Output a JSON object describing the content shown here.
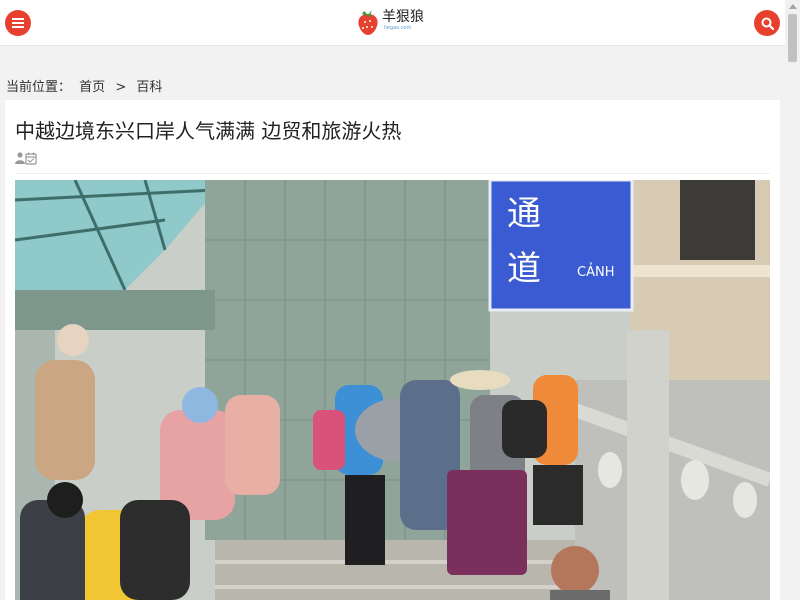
{
  "header": {
    "logo_text": "羊狠狼",
    "logo_subtext": "liegao.com"
  },
  "breadcrumb": {
    "prefix": "当前位置：",
    "items": [
      "首页",
      "百科"
    ],
    "separator": ">"
  },
  "article": {
    "title": "中越边境东兴口岸人气满满 边贸和旅游火热",
    "photo": {
      "sign_line1": "通",
      "sign_line2": "道",
      "sign_latin": "CẢNH"
    }
  },
  "colors": {
    "accent": "#e8402f",
    "sign_blue": "#3a5bd1"
  }
}
